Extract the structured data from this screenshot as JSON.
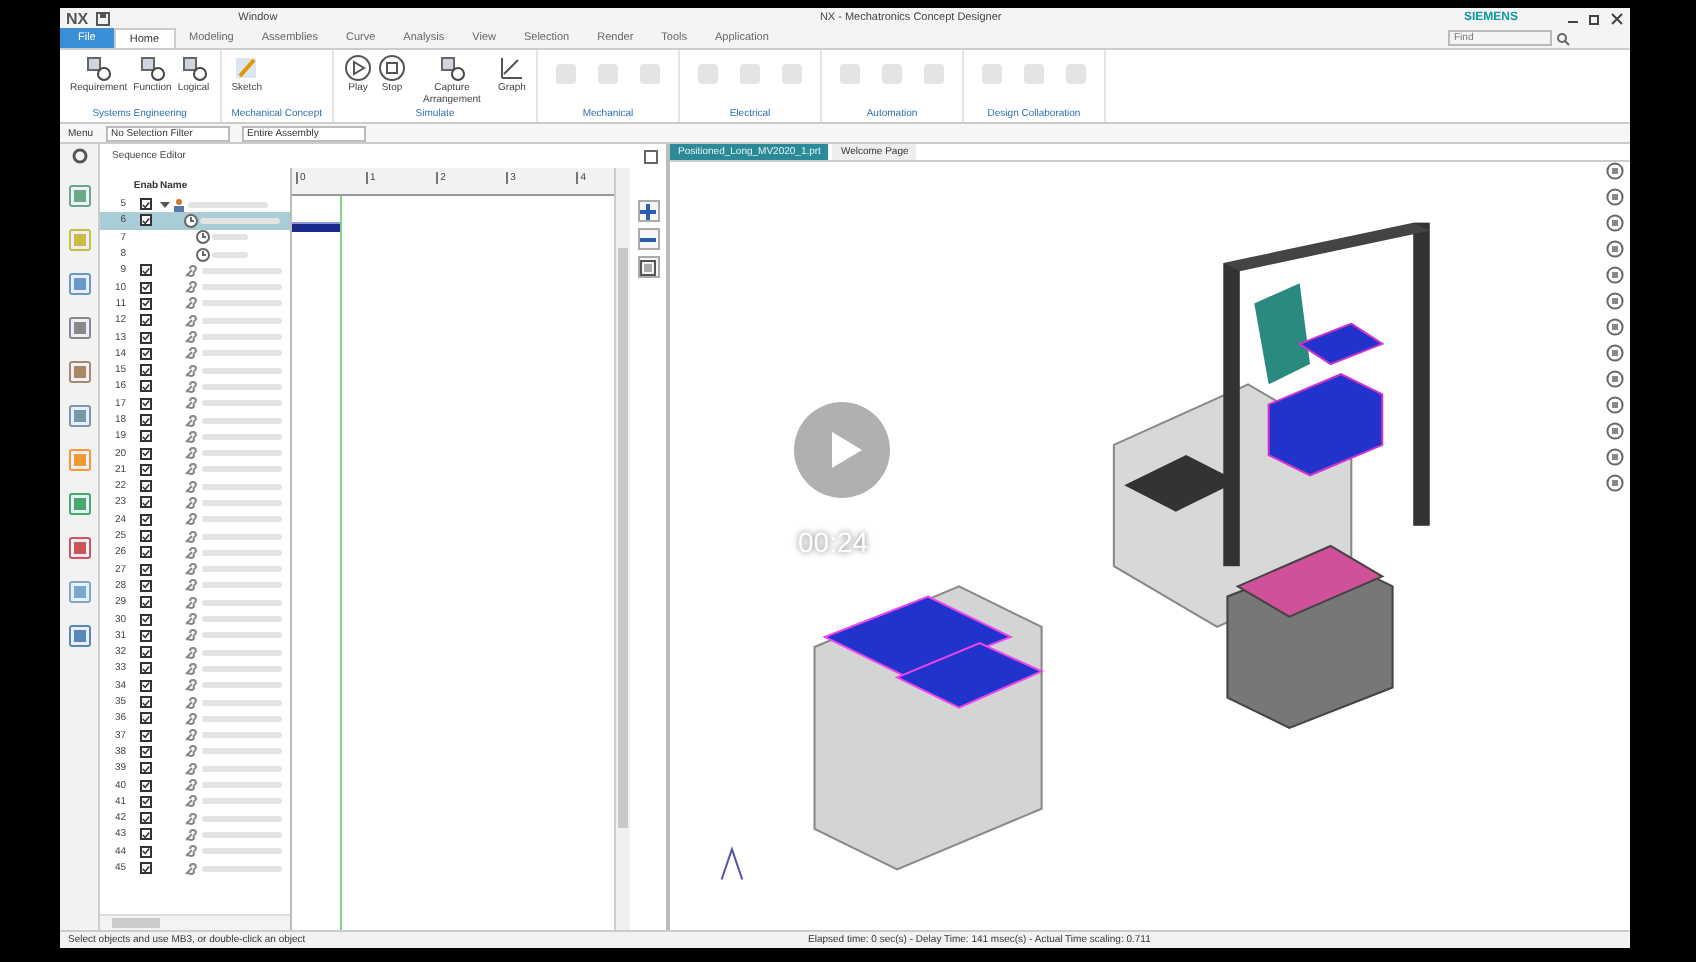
{
  "window": {
    "logo": "NX",
    "quick_menu": "Window",
    "title": "NX - Mechatronics Concept Designer",
    "brand": "SIEMENS"
  },
  "search": {
    "placeholder": "Find"
  },
  "ribbon_tabs": [
    {
      "label": "File",
      "selected": false,
      "kind": "file"
    },
    {
      "label": "Home",
      "selected": true,
      "kind": "tab"
    },
    {
      "label": "Modeling",
      "selected": false,
      "kind": "tab"
    },
    {
      "label": "Assemblies",
      "selected": false,
      "kind": "tab"
    },
    {
      "label": "Curve",
      "selected": false,
      "kind": "tab"
    },
    {
      "label": "Analysis",
      "selected": false,
      "kind": "tab"
    },
    {
      "label": "View",
      "selected": false,
      "kind": "tab"
    },
    {
      "label": "Selection",
      "selected": false,
      "kind": "tab"
    },
    {
      "label": "Render",
      "selected": false,
      "kind": "tab"
    },
    {
      "label": "Tools",
      "selected": false,
      "kind": "tab"
    },
    {
      "label": "Application",
      "selected": false,
      "kind": "tab"
    }
  ],
  "ribbon_groups": [
    {
      "label": "Systems Engineering",
      "buttons": [
        {
          "label": "Requirement",
          "kind": "tool"
        },
        {
          "label": "Function",
          "kind": "tool"
        },
        {
          "label": "Logical",
          "kind": "tool"
        }
      ]
    },
    {
      "label": "Mechanical Concept",
      "buttons": [
        {
          "label": "Sketch",
          "kind": "sketch"
        }
      ]
    },
    {
      "label": "Simulate",
      "buttons": [
        {
          "label": "Play",
          "kind": "play"
        },
        {
          "label": "Stop",
          "kind": "stop"
        },
        {
          "label": "Capture Arrangement",
          "kind": "tool"
        },
        {
          "label": "Graph",
          "kind": "graph"
        }
      ]
    },
    {
      "label": "Mechanical"
    },
    {
      "label": "Electrical"
    },
    {
      "label": "Automation"
    },
    {
      "label": "Design Collaboration"
    }
  ],
  "selection_bar": {
    "menu": "Menu",
    "filter": "No Selection Filter",
    "scope": "Entire Assembly"
  },
  "sequence_editor": {
    "title": "Sequence Editor",
    "columns": [
      "Enab",
      "Name"
    ],
    "ruler_ticks": [
      "0",
      "1",
      "2",
      "3",
      "4"
    ],
    "rows": [
      {
        "number": "5",
        "kind": "assembly",
        "checked": true,
        "selected": false
      },
      {
        "number": "6",
        "kind": "operation",
        "checked": true,
        "selected": true
      },
      {
        "number": "7",
        "kind": "sub-operation",
        "selected": false
      },
      {
        "number": "8",
        "kind": "sub-operation",
        "selected": false
      },
      {
        "number": "9",
        "kind": "link",
        "checked": true,
        "selected": false
      },
      {
        "number": "10",
        "kind": "link",
        "checked": true,
        "selected": false
      },
      {
        "number": "11",
        "kind": "link",
        "checked": true,
        "selected": false
      },
      {
        "number": "12",
        "kind": "link",
        "checked": true,
        "selected": false
      },
      {
        "number": "13",
        "kind": "link",
        "checked": true,
        "selected": false
      },
      {
        "number": "14",
        "kind": "link",
        "checked": true,
        "selected": false
      },
      {
        "number": "15",
        "kind": "link",
        "checked": true,
        "selected": false
      },
      {
        "number": "16",
        "kind": "link",
        "checked": true,
        "selected": false
      },
      {
        "number": "17",
        "kind": "link",
        "checked": true,
        "selected": false
      },
      {
        "number": "18",
        "kind": "link",
        "checked": true,
        "selected": false
      },
      {
        "number": "19",
        "kind": "link",
        "checked": true,
        "selected": false
      },
      {
        "number": "20",
        "kind": "link",
        "checked": true,
        "selected": false
      },
      {
        "number": "21",
        "kind": "link",
        "checked": true,
        "selected": false
      },
      {
        "number": "22",
        "kind": "link",
        "checked": true,
        "selected": false
      },
      {
        "number": "23",
        "kind": "link",
        "checked": true,
        "selected": false
      },
      {
        "number": "24",
        "kind": "link",
        "checked": true,
        "selected": false
      },
      {
        "number": "25",
        "kind": "link",
        "checked": true,
        "selected": false
      },
      {
        "number": "26",
        "kind": "link",
        "checked": true,
        "selected": false
      },
      {
        "number": "27",
        "kind": "link",
        "checked": true,
        "selected": false
      },
      {
        "number": "28",
        "kind": "link",
        "checked": true,
        "selected": false
      },
      {
        "number": "29",
        "kind": "link",
        "checked": true,
        "selected": false
      },
      {
        "number": "30",
        "kind": "link",
        "checked": true,
        "selected": false
      },
      {
        "number": "31",
        "kind": "link",
        "checked": true,
        "selected": false
      },
      {
        "number": "32",
        "kind": "link",
        "checked": true,
        "selected": false
      },
      {
        "number": "33",
        "kind": "link",
        "checked": true,
        "selected": false
      },
      {
        "number": "34",
        "kind": "link",
        "checked": true,
        "selected": false
      },
      {
        "number": "35",
        "kind": "link",
        "checked": true,
        "selected": false
      },
      {
        "number": "36",
        "kind": "link",
        "checked": true,
        "selected": false
      },
      {
        "number": "37",
        "kind": "link",
        "checked": true,
        "selected": false
      },
      {
        "number": "38",
        "kind": "link",
        "checked": true,
        "selected": false
      },
      {
        "number": "39",
        "kind": "link",
        "checked": true,
        "selected": false
      },
      {
        "number": "40",
        "kind": "link",
        "checked": true,
        "selected": false
      },
      {
        "number": "41",
        "kind": "link",
        "checked": true,
        "selected": false
      },
      {
        "number": "42",
        "kind": "link",
        "checked": true,
        "selected": false
      },
      {
        "number": "43",
        "kind": "link",
        "checked": true,
        "selected": false
      },
      {
        "number": "44",
        "kind": "link",
        "checked": true,
        "selected": false
      },
      {
        "number": "45",
        "kind": "link",
        "checked": true,
        "selected": false
      }
    ]
  },
  "graphics": {
    "tabs": [
      {
        "label": "Positioned_Long_MV2020_1.prt",
        "selected": true
      },
      {
        "label": "Welcome Page",
        "selected": false
      }
    ]
  },
  "video": {
    "time": "00:24"
  },
  "status_bar": {
    "prompt": "Select objects and use MB3, or double-click an object",
    "timing": "Elapsed time: 0 sec(s) - Delay Time: 141 msec(s) - Actual Time scaling: 0.711"
  }
}
